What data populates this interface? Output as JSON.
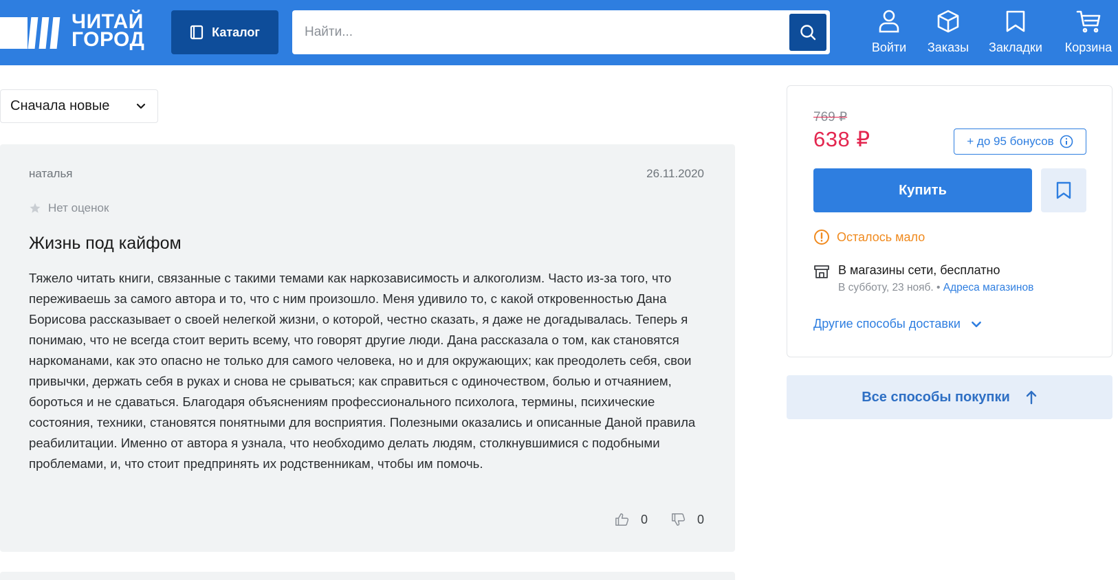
{
  "header": {
    "logo_line1": "ЧИТАЙ",
    "logo_line2": "ГОРОД",
    "catalog_label": "Каталог",
    "search_placeholder": "Найти...",
    "nav": [
      {
        "label": "Войти",
        "icon": "user-icon"
      },
      {
        "label": "Заказы",
        "icon": "box-icon"
      },
      {
        "label": "Закладки",
        "icon": "bookmark-icon"
      },
      {
        "label": "Корзина",
        "icon": "cart-icon"
      }
    ]
  },
  "sort": {
    "selected": "Сначала новые"
  },
  "review": {
    "author": "наталья",
    "date": "26.11.2020",
    "rating_text": "Нет оценок",
    "title": "Жизнь под кайфом",
    "body": "Тяжело читать книги, связанные с такими темами как наркозависимость и алкоголизм. Часто из-за того, что переживаешь за самого автора и то, что с ним произошло. Меня удивило то, с какой откровенностью Дана Борисова рассказывает о своей нелегкой жизни, о которой, честно сказать, я даже не догадывалась. Теперь я понимаю, что не всегда стоит верить всему, что говорят другие люди. Дана рассказала о том, как становятся наркоманами, как это опасно не только для самого человека, но и для окружающих; как преодолеть себя, свои привычки, держать себя в руках и снова не срываться; как справиться с одиночеством, болью и отчаянием, бороться и не сдаваться. Благодаря объяснениям профессионального психолога, термины, психические состояния, техники, становятся понятными для восприятия. Полезными оказались и описанные Даной правила реабилитации. Именно от автора я узнала, что необходимо делать людям, столкнувшимися с подобными проблемами, и, что стоит предпринять их родственникам, чтобы им помочь.",
    "likes": "0",
    "dislikes": "0"
  },
  "buy_panel": {
    "old_price": "769 ₽",
    "price": "638 ₽",
    "bonus": "+ до 95 бонусов",
    "buy_label": "Купить",
    "stock_text": "Осталось мало",
    "store_label": "В магазины сети, ",
    "store_free": "бесплатно",
    "store_date": "В субботу, 23 нояб. • ",
    "store_link": "Адреса магазинов",
    "other_delivery": "Другие способы доставки",
    "all_ways": "Все способы покупки"
  },
  "colors": {
    "header": "#2e7ee0",
    "header_dark": "#0e4d9a",
    "price": "#e3264f",
    "stock": "#f08a1e",
    "link": "#2e7ee0"
  }
}
